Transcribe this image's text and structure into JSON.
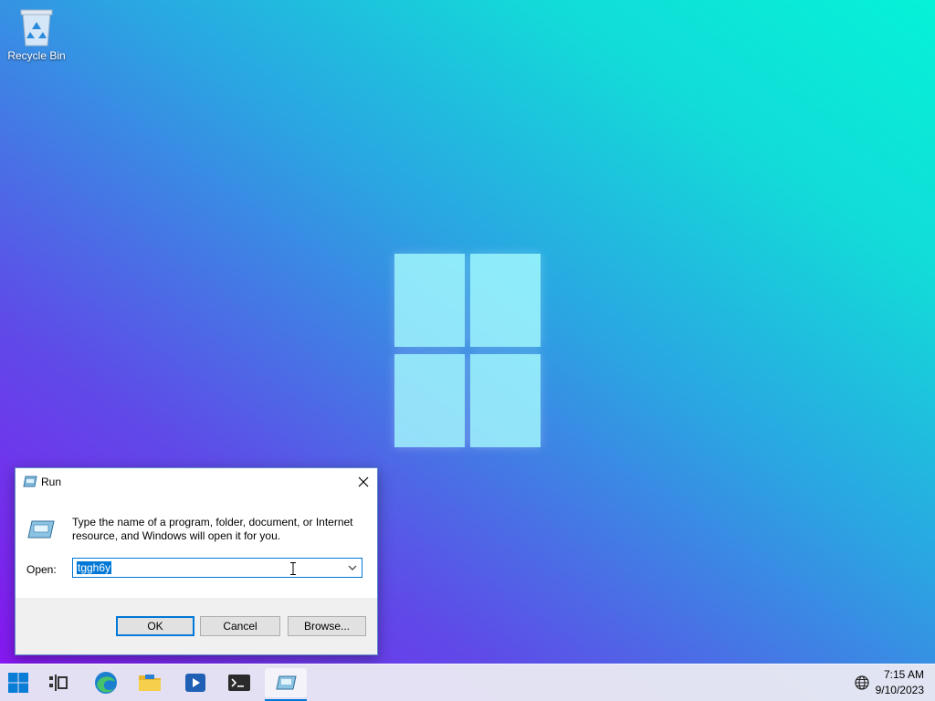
{
  "desktop": {
    "recycle_bin_label": "Recycle Bin"
  },
  "run_dialog": {
    "title": "Run",
    "description": "Type the name of a program, folder, document, or Internet resource, and Windows will open it for you.",
    "open_label": "Open:",
    "open_value": "tggh6y",
    "ok_label": "OK",
    "cancel_label": "Cancel",
    "browse_label": "Browse..."
  },
  "taskbar": {
    "items": [
      "start-icon",
      "widgets-icon",
      "edge-icon",
      "file-explorer-icon",
      "media-player-icon",
      "terminal-icon",
      "run-icon"
    ],
    "time": "7:15 AM",
    "date": "9/10/2023"
  },
  "colors": {
    "accent": "#0078d7",
    "wallpaper_left": "#8a12f2",
    "wallpaper_right": "#05f2d8"
  }
}
